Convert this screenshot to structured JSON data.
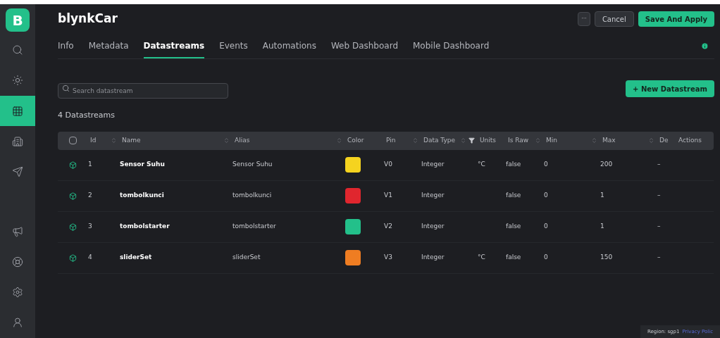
{
  "logo": "B",
  "sidebar": {
    "items": [
      {
        "selected": false
      },
      {
        "selected": false
      },
      {
        "selected": true
      },
      {
        "selected": false
      },
      {
        "selected": false
      },
      {
        "selected": false
      },
      {
        "selected": false
      },
      {
        "selected": false
      },
      {
        "selected": false
      }
    ]
  },
  "header": {
    "title": "blynkCar",
    "more_button": "···",
    "buttons": [
      "Cancel",
      "Save And Apply"
    ]
  },
  "tabs": [
    {
      "label": "Info",
      "selected": false
    },
    {
      "label": "Metadata",
      "selected": false
    },
    {
      "label": "Datastreams",
      "selected": true
    },
    {
      "label": "Events",
      "selected": false
    },
    {
      "label": "Automations",
      "selected": false
    },
    {
      "label": "Web Dashboard",
      "selected": false
    },
    {
      "label": "Mobile Dashboard",
      "selected": false
    }
  ],
  "search": {
    "placeholder": "Search datastream"
  },
  "new_button": "+ New Datastream",
  "count": "4 Datastreams",
  "table": {
    "select_all": {
      "checked": false
    },
    "columns": [
      {
        "label": "Id",
        "sortable": true,
        "filterable": false
      },
      {
        "label": "Name",
        "sortable": true,
        "filterable": false
      },
      {
        "label": "Alias",
        "sortable": true,
        "filterable": false
      },
      {
        "label": "Color",
        "sortable": false,
        "filterable": false
      },
      {
        "label": "Pin",
        "sortable": true,
        "filterable": false
      },
      {
        "label": "Data Type",
        "sortable": true,
        "filterable": true
      },
      {
        "label": "Units",
        "sortable": false,
        "filterable": false
      },
      {
        "label": "Is Raw",
        "sortable": true,
        "filterable": false
      },
      {
        "label": "Min",
        "sortable": true,
        "filterable": false
      },
      {
        "label": "Max",
        "sortable": true,
        "filterable": false
      },
      {
        "label": "De",
        "sortable": false,
        "filterable": false
      },
      {
        "label": "Actions",
        "sortable": false,
        "filterable": false
      }
    ],
    "rows": [
      {
        "id": "1",
        "name": "Sensor Suhu",
        "alias": "Sensor Suhu",
        "color": "#f5d31f",
        "pin": "V0",
        "data_type": "Integer",
        "units": "°C",
        "is_raw": "false",
        "min": "0",
        "max": "200",
        "de": "–"
      },
      {
        "id": "2",
        "name": "tombolkunci",
        "alias": "tombolkunci",
        "color": "#e0262e",
        "pin": "V1",
        "data_type": "Integer",
        "is_raw": "false",
        "min": "0",
        "max": "1",
        "de": "–"
      },
      {
        "id": "3",
        "name": "tombolstarter",
        "alias": "tombolstarter",
        "color": "#23c08a",
        "pin": "V2",
        "data_type": "Integer",
        "is_raw": "false",
        "min": "0",
        "max": "1",
        "de": "–"
      },
      {
        "id": "4",
        "name": "sliderSet",
        "alias": "sliderSet",
        "color": "#ef7d22",
        "pin": "V3",
        "data_type": "Integer",
        "units": "°C",
        "is_raw": "false",
        "min": "0",
        "max": "150",
        "de": "–"
      }
    ]
  },
  "footer": {
    "region": "Region: sgp1",
    "link": "Privacy Polic"
  }
}
